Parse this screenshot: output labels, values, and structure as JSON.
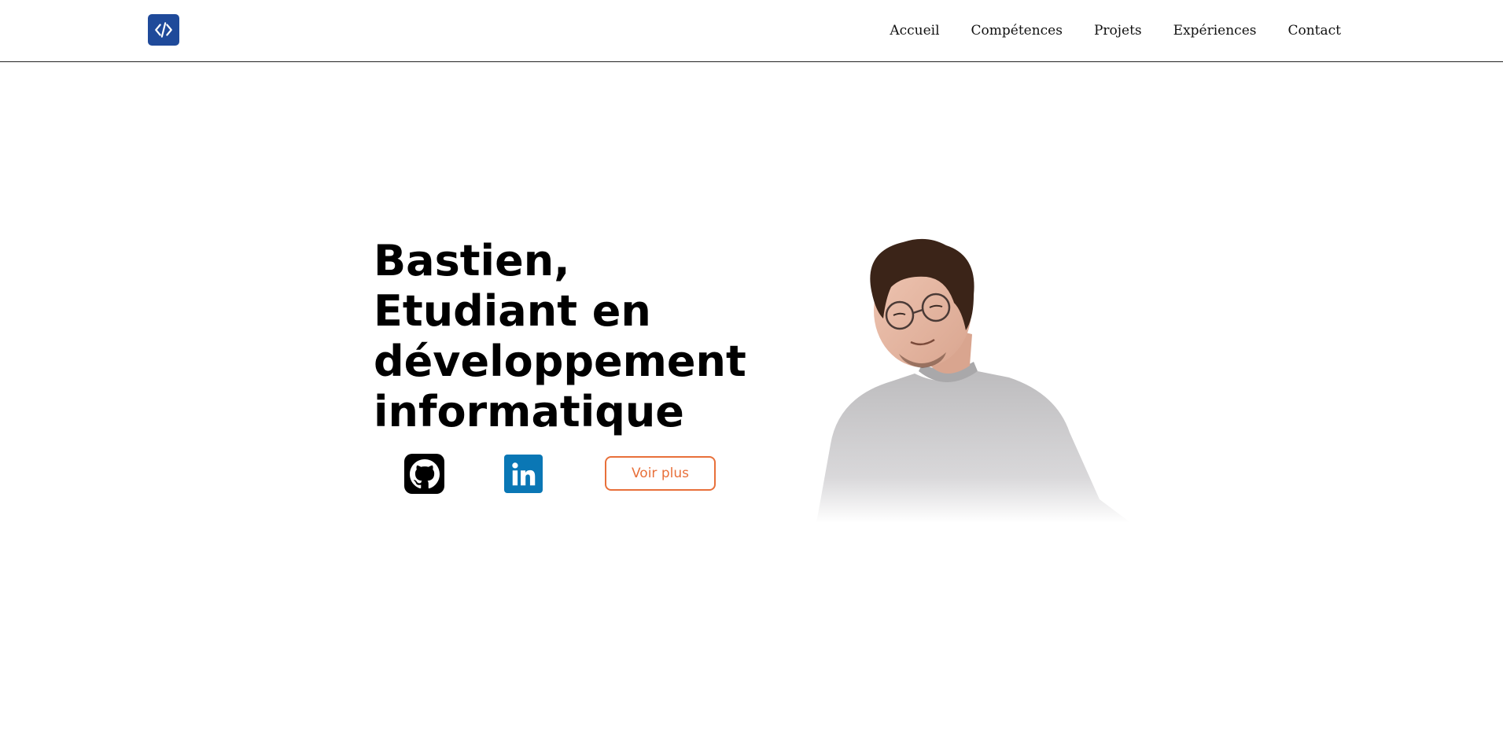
{
  "navbar": {
    "logo_icon": "code-brackets-icon",
    "logo_color": "#1f4a9a",
    "links": [
      "Accueil",
      "Compétences",
      "Projets",
      "Expériences",
      "Contact"
    ]
  },
  "hero": {
    "title_lines": [
      "Bastien,",
      "Etudiant en",
      "développement",
      "informatique"
    ],
    "github_icon": "github-icon",
    "linkedin_icon": "linkedin-icon",
    "linkedin_color": "#0a77b5",
    "cta_label": "Voir plus",
    "cta_color": "#e8703a",
    "photo": "portrait-photo"
  }
}
